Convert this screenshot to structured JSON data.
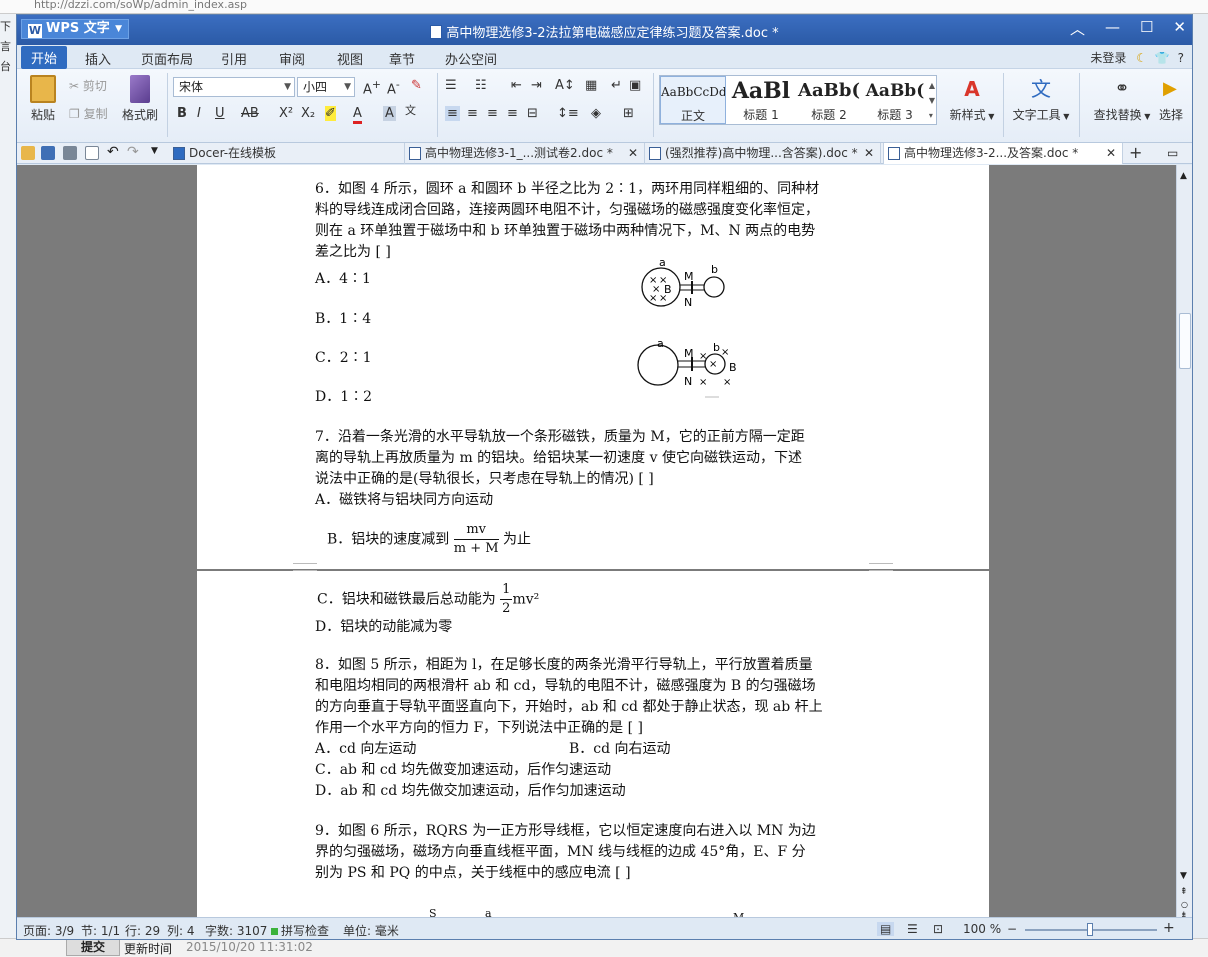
{
  "background": {
    "url": "http://dzzi.com/soWp/admin_index.asp",
    "left_labels": [
      "下",
      "言",
      "台"
    ],
    "submit_label": "提交",
    "update_time_label": "更新时间",
    "update_time": "2015/10/20 11:31:02"
  },
  "window": {
    "app_name": "WPS 文字",
    "title": "高中物理选修3-2法拉第电磁感应定律练习题及答案.doc *"
  },
  "menu": {
    "items": [
      "开始",
      "插入",
      "页面布局",
      "引用",
      "审阅",
      "视图",
      "章节",
      "办公空间"
    ],
    "login": "未登录",
    "help": "?"
  },
  "ribbon": {
    "paste": "粘贴",
    "cut": "剪切",
    "copy": "复制",
    "format_painter": "格式刷",
    "font_name": "宋体",
    "font_size": "小四",
    "styles": [
      {
        "sample": "AaBbCcDd",
        "name": "正文"
      },
      {
        "sample": "AaBl",
        "name": "标题 1"
      },
      {
        "sample": "AaBb(",
        "name": "标题 2"
      },
      {
        "sample": "AaBb(",
        "name": "标题 3"
      }
    ],
    "new_style": "新样式",
    "text_tools": "文字工具",
    "find_replace": "查找替换",
    "select": "选择"
  },
  "tabs": [
    {
      "label": "Docer-在线模板",
      "active": false
    },
    {
      "label": "高中物理选修3-1_...测试卷2.doc *",
      "active": false
    },
    {
      "label": "(强烈推荐)高中物理...含答案).doc *",
      "active": false
    },
    {
      "label": "高中物理选修3-2...及答案.doc *",
      "active": true
    }
  ],
  "document": {
    "q6": [
      "6．如图 4 所示，圆环 a 和圆环 b 半径之比为 2∶1，两环用同样粗细的、同种材",
      "料的导线连成闭合回路，连接两圆环电阻不计，匀强磁场的磁感强度变化率恒定，",
      "则在 a 环单独置于磁场中和 b 环单独置于磁场中两种情况下，M、N 两点的电势",
      "差之比为 [ ]"
    ],
    "q6_options": [
      "A．4∶1",
      "B．1∶4",
      "C．2∶1",
      "D．1∶2"
    ],
    "fig_labels": {
      "a": "a",
      "b": "b",
      "m": "M",
      "n": "N",
      "field": "B",
      "cross": "×"
    },
    "q7": [
      "7．沿着一条光滑的水平导轨放一个条形磁铁，质量为 M，它的正前方隔一定距",
      "离的导轨上再放质量为 m 的铝块。给铝块某一初速度 v 使它向磁铁运动，下述",
      "说法中正确的是(导轨很长，只考虑在导轨上的情况) [ ]",
      "A．磁铁将与铝块同方向运动"
    ],
    "q7_b_prefix": "B．铝块的速度减到",
    "q7_b_num": "mv",
    "q7_b_den": "m + M",
    "q7_b_suffix": "为止",
    "q7_c_prefix": "C．铝块和磁铁最后总动能为",
    "q7_c_num": "1",
    "q7_c_den": "2",
    "q7_c_suffix": "mv²",
    "q7_d": "D．铝块的动能减为零",
    "q8": [
      "8．如图 5 所示，相距为 l，在足够长度的两条光滑平行导轨上，平行放置着质量",
      "和电阻均相同的两根滑杆 ab 和 cd，导轨的电阻不计，磁感强度为 B 的匀强磁场",
      "的方向垂直于导轨平面竖直向下，开始时，ab 和 cd 都处于静止状态，现 ab 杆上",
      "作用一个水平方向的恒力 F，下列说法中正确的是 [ ]"
    ],
    "q8_a": "A．cd 向左运动",
    "q8_b": "B．cd 向右运动",
    "q8_c": "C．ab 和 cd 均先做变加速运动，后作匀速运动",
    "q8_d": "D．ab 和 cd 均先做交加速运动，后作匀加速运动",
    "q9": [
      "9．如图 6 所示，RQRS 为一正方形导线框，它以恒定速度向右进入以 MN 为边",
      "界的匀强磁场，磁场方向垂直线框平面，MN 线与线框的边成 45°角，E、F 分",
      "别为 PS 和 PQ 的中点，关于线框中的感应电流 [ ]"
    ],
    "fig6_labels": [
      "S",
      "a",
      "M"
    ]
  },
  "status": {
    "page": "页面: 3/9",
    "section": "节: 1/1",
    "row": "行: 29",
    "col": "列: 4",
    "words": "字数: 3107",
    "spell": "拼写检查",
    "unit": "单位: 毫米",
    "zoom": "100 %"
  }
}
